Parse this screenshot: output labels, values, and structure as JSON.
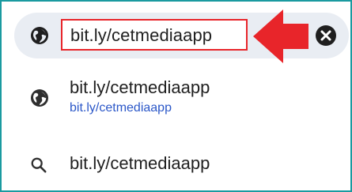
{
  "omnibox": {
    "url": "bit.ly/cetmediaapp"
  },
  "suggestions": [
    {
      "title": "bit.ly/cetmediaapp",
      "url": "bit.ly/cetmediaapp",
      "icon": "globe-icon"
    },
    {
      "title": "bit.ly/cetmediaapp",
      "icon": "search-icon"
    }
  ],
  "colors": {
    "frame_border": "#1a9aa0",
    "omnibox_bg": "#e9edf3",
    "highlight_red": "#e8252a",
    "link_blue": "#2b57c8"
  }
}
